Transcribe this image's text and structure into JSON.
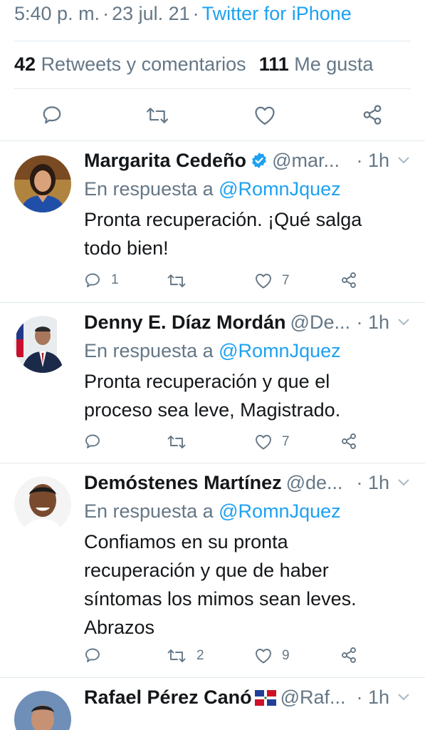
{
  "detail": {
    "time": "5:40 p. m.",
    "date": "23 jul. 21",
    "source": "Twitter for iPhone",
    "retweets_count": "42",
    "retweets_label": "Retweets y comentarios",
    "likes_count": "111",
    "likes_label": "Me gusta"
  },
  "tweets": [
    {
      "name": "Margarita Cedeño",
      "handle": "@mar...",
      "time": "· 1h",
      "reply_prefix": "En respuesta a",
      "reply_to": "@RomnJquez",
      "text": "Pronta recuperación. ¡Qué salga todo bien!",
      "replies": "1",
      "retweets": "",
      "likes": "7"
    },
    {
      "name": "Denny E. Díaz Mordán",
      "handle": "@De...",
      "time": "· 1h",
      "reply_prefix": "En respuesta a",
      "reply_to": "@RomnJquez",
      "text": "Pronta recuperación y que el proceso sea leve, Magistrado.",
      "replies": "",
      "retweets": "",
      "likes": "7"
    },
    {
      "name": "Demóstenes Martínez",
      "handle": "@de...",
      "time": "· 1h",
      "reply_prefix": "En respuesta a",
      "reply_to": "@RomnJquez",
      "text": "Confiamos en su pronta recuperación y que de haber síntomas los mimos sean leves. Abrazos",
      "replies": "",
      "retweets": "2",
      "likes": "9"
    },
    {
      "name": "Rafael Pérez Canó",
      "handle": "@Raf...",
      "time": "· 1h"
    }
  ]
}
